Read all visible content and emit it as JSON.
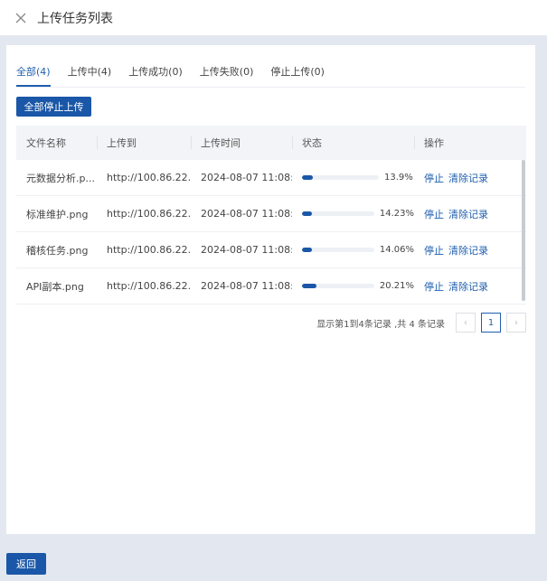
{
  "header": {
    "title": "上传任务列表"
  },
  "tabs": [
    {
      "label": "全部(4)"
    },
    {
      "label": "上传中(4)"
    },
    {
      "label": "上传成功(0)"
    },
    {
      "label": "上传失败(0)"
    },
    {
      "label": "停止上传(0)"
    }
  ],
  "toolbar": {
    "stop_all_label": "全部停止上传"
  },
  "table": {
    "columns": [
      "文件名称",
      "上传到",
      "上传时间",
      "状态",
      "操作"
    ],
    "rows": [
      {
        "name": "元数据分析.p...",
        "target": "http://100.86.22...",
        "time": "2024-08-07 11:08:...",
        "progress": 13.9,
        "pct": "13.9%",
        "action_stop": "停止",
        "action_clear": "清除记录"
      },
      {
        "name": "标准维护.png",
        "target": "http://100.86.22...",
        "time": "2024-08-07 11:08:...",
        "progress": 14.23,
        "pct": "14.23%",
        "action_stop": "停止",
        "action_clear": "清除记录"
      },
      {
        "name": "稽核任务.png",
        "target": "http://100.86.22...",
        "time": "2024-08-07 11:08:...",
        "progress": 14.06,
        "pct": "14.06%",
        "action_stop": "停止",
        "action_clear": "清除记录"
      },
      {
        "name": "API副本.png",
        "target": "http://100.86.22...",
        "time": "2024-08-07 11:08:...",
        "progress": 20.21,
        "pct": "20.21%",
        "action_stop": "停止",
        "action_clear": "清除记录"
      }
    ]
  },
  "pagination": {
    "info": "显示第1到4条记录 ,共 4 条记录",
    "current_page": "1",
    "prev": "‹",
    "next": "›"
  },
  "footer": {
    "back_label": "返回"
  },
  "colors": {
    "accent": "#1a57a8",
    "link": "#1f5fae",
    "background": "#e3e8f0"
  },
  "icons": {
    "close": "close-icon",
    "prev": "chevron-left-icon",
    "next": "chevron-right-icon"
  }
}
